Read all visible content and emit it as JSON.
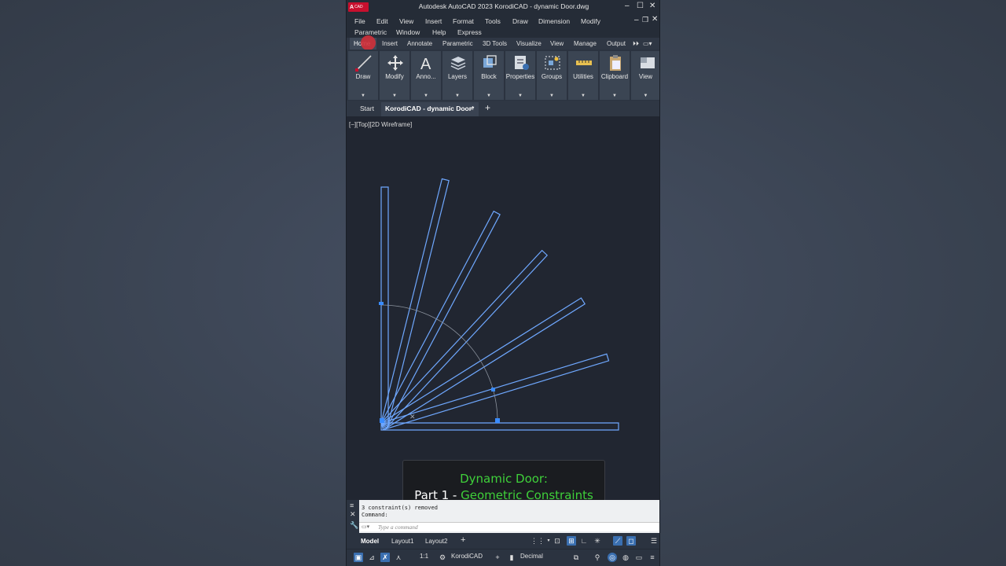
{
  "window": {
    "logo_text": "A",
    "logo_sub": "CAD",
    "title": "Autodesk AutoCAD 2023   KorodiCAD - dynamic Door.dwg"
  },
  "menu": [
    "File",
    "Edit",
    "View",
    "Insert",
    "Format",
    "Tools",
    "Draw",
    "Dimension",
    "Modify",
    "Parametric",
    "Window",
    "Help",
    "Express"
  ],
  "ribbon_tabs": [
    "Home",
    "Insert",
    "Annotate",
    "Parametric",
    "3D Tools",
    "Visualize",
    "View",
    "Manage",
    "Output"
  ],
  "ribbon_panels": [
    "Draw",
    "Modify",
    "Anno...",
    "Layers",
    "Block",
    "Properties",
    "Groups",
    "Utilities",
    "Clipboard",
    "View"
  ],
  "doc_tabs": {
    "start": "Start",
    "active": "KorodiCAD - dynamic Door*",
    "close": "×",
    "add": "+"
  },
  "viewport": {
    "label": "[−][Top][2D Wireframe]"
  },
  "caption": {
    "line1": "Dynamic Door:",
    "line2_prefix": "Part 1 - ",
    "line2_highlight": "Geometric Constraints"
  },
  "command": {
    "history1": "3 constraint(s) removed",
    "history2": "Command:",
    "placeholder": "Type a command"
  },
  "layout_tabs": [
    "Model",
    "Layout1",
    "Layout2",
    "+"
  ],
  "status": {
    "scale": "1:1",
    "workspace": "KorodiCAD",
    "units": "Decimal"
  },
  "colors": {
    "door_line": "#6fa8ff",
    "caption_green": "#3fd03a",
    "active_toggle": "#3a6fb0"
  }
}
